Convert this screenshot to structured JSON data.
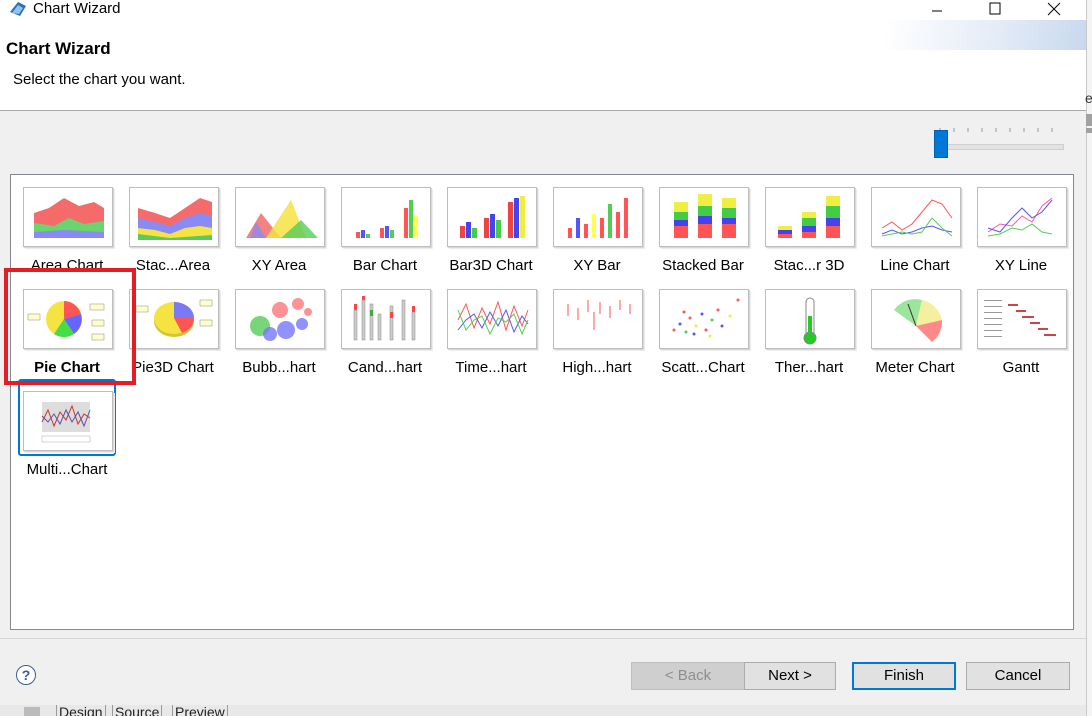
{
  "window": {
    "title": "Chart Wizard"
  },
  "header": {
    "title": "Chart Wizard",
    "subtitle": "Select the chart you want."
  },
  "edge_letter": "e",
  "charts": [
    {
      "label": "Area Chart",
      "icon": "area-chart-icon"
    },
    {
      "label": "Stac...Area",
      "icon": "stacked-area-chart-icon"
    },
    {
      "label": "XY Area",
      "icon": "xy-area-chart-icon"
    },
    {
      "label": "Bar Chart",
      "icon": "bar-chart-icon"
    },
    {
      "label": "Bar3D Chart",
      "icon": "bar3d-chart-icon"
    },
    {
      "label": "XY Bar",
      "icon": "xy-bar-chart-icon"
    },
    {
      "label": "Stacked Bar",
      "icon": "stacked-bar-chart-icon"
    },
    {
      "label": "Stac...r 3D",
      "icon": "stacked-bar3d-chart-icon"
    },
    {
      "label": "Line Chart",
      "icon": "line-chart-icon"
    },
    {
      "label": "XY Line",
      "icon": "xy-line-chart-icon"
    },
    {
      "label": "Pie Chart",
      "icon": "pie-chart-icon",
      "selected": true
    },
    {
      "label": "Pie3D Chart",
      "icon": "pie3d-chart-icon"
    },
    {
      "label": "Bubb...hart",
      "icon": "bubble-chart-icon"
    },
    {
      "label": "Cand...hart",
      "icon": "candlestick-chart-icon"
    },
    {
      "label": "Time...hart",
      "icon": "time-series-chart-icon"
    },
    {
      "label": "High...hart",
      "icon": "high-low-chart-icon"
    },
    {
      "label": "Scatt...Chart",
      "icon": "scatter-chart-icon"
    },
    {
      "label": "Ther...hart",
      "icon": "thermometer-chart-icon"
    },
    {
      "label": "Meter Chart",
      "icon": "meter-chart-icon"
    },
    {
      "label": "Gantt",
      "icon": "gantt-chart-icon"
    },
    {
      "label": "Multi...Chart",
      "icon": "multi-chart-icon"
    }
  ],
  "buttons": {
    "back": "< Back",
    "next": "Next >",
    "finish": "Finish",
    "cancel": "Cancel",
    "help": "?"
  },
  "bottom_tabs": [
    "Design",
    "Source",
    "Preview"
  ],
  "colors": {
    "accent": "#0078d7",
    "annotation_red": "#e41c24"
  }
}
